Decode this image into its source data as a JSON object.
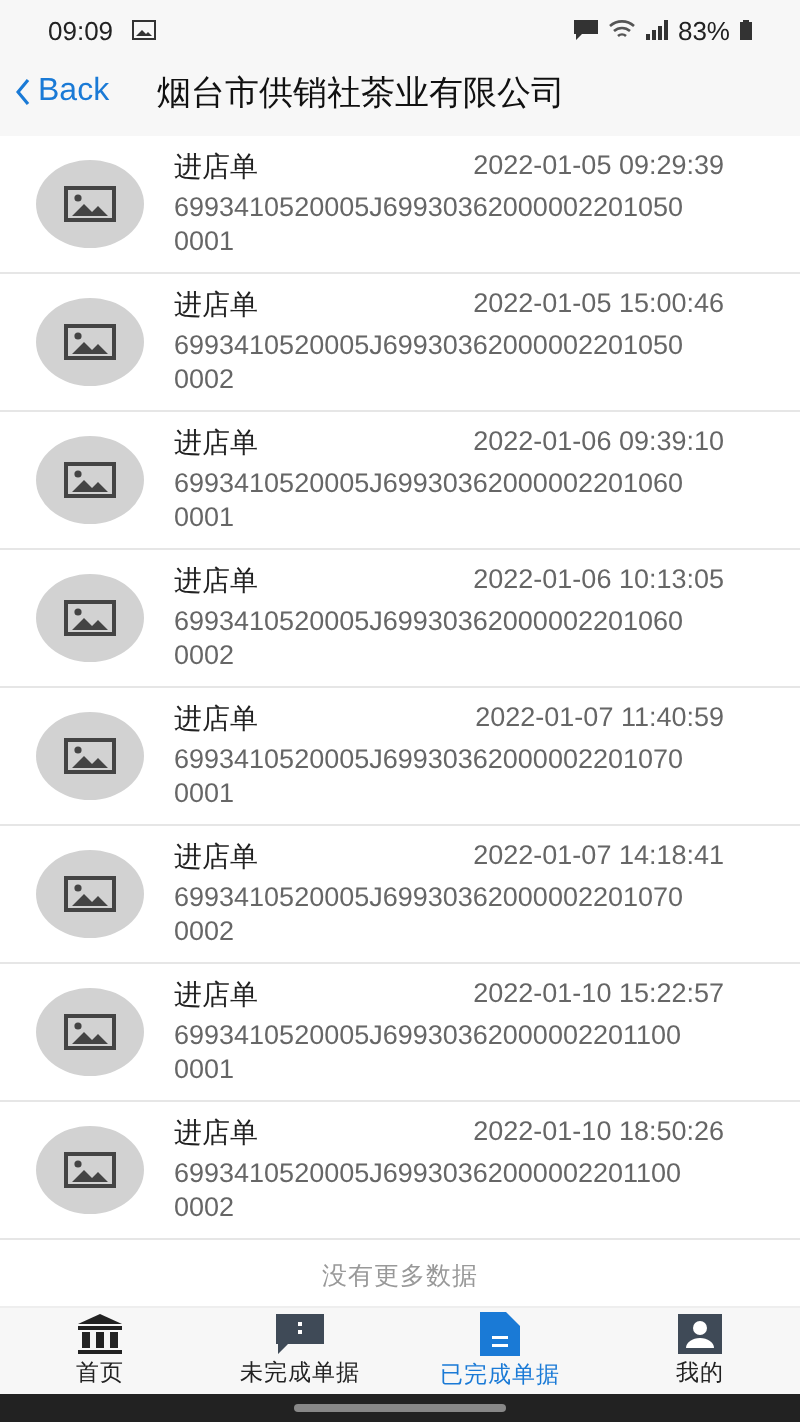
{
  "status_bar": {
    "time": "09:09",
    "battery": "83%"
  },
  "header": {
    "back": "Back",
    "title": "烟台市供销社茶业有限公司"
  },
  "rows": [
    {
      "type": "进店单",
      "time": "2022-01-05 09:29:39",
      "code": "6993410520005J699303620000022010500001"
    },
    {
      "type": "进店单",
      "time": "2022-01-05 15:00:46",
      "code": "6993410520005J699303620000022010500002"
    },
    {
      "type": "进店单",
      "time": "2022-01-06 09:39:10",
      "code": "6993410520005J699303620000022010600001"
    },
    {
      "type": "进店单",
      "time": "2022-01-06 10:13:05",
      "code": "6993410520005J699303620000022010600002"
    },
    {
      "type": "进店单",
      "time": "2022-01-07 11:40:59",
      "code": "6993410520005J699303620000022010700001"
    },
    {
      "type": "进店单",
      "time": "2022-01-07 14:18:41",
      "code": "6993410520005J699303620000022010700002"
    },
    {
      "type": "进店单",
      "time": "2022-01-10 15:22:57",
      "code": "6993410520005J699303620000022011000001"
    },
    {
      "type": "进店单",
      "time": "2022-01-10 18:50:26",
      "code": "6993410520005J699303620000022011000002"
    }
  ],
  "footer_note": "没有更多数据",
  "tabs": [
    {
      "label": "首页",
      "kind": "home",
      "selected": false
    },
    {
      "label": "未完成单据",
      "kind": "pending",
      "selected": false
    },
    {
      "label": "已完成单据",
      "kind": "done",
      "selected": true
    },
    {
      "label": "我的",
      "kind": "me",
      "selected": false
    }
  ]
}
